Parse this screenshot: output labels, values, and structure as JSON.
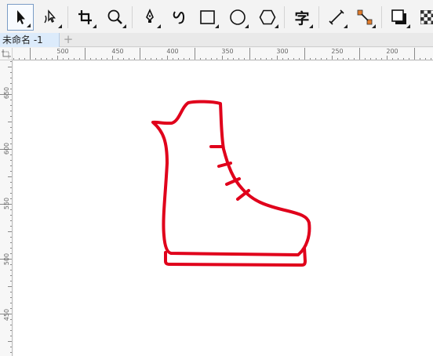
{
  "toolbar": {
    "tools": [
      {
        "name": "pick-tool",
        "active": true
      },
      {
        "name": "shape-tool"
      },
      {
        "name": "crop-tool"
      },
      {
        "name": "zoom-tool"
      },
      {
        "name": "pen-tool"
      },
      {
        "name": "artistic-media-tool"
      },
      {
        "name": "rectangle-tool"
      },
      {
        "name": "ellipse-tool"
      },
      {
        "name": "polygon-tool"
      },
      {
        "name": "text-tool",
        "glyph": "字"
      },
      {
        "name": "dimension-tool"
      },
      {
        "name": "connector-tool"
      },
      {
        "name": "drop-shadow-tool"
      },
      {
        "name": "transparency-tool"
      }
    ]
  },
  "document_tab": {
    "title": "未命名 -1",
    "add_symbol": "+"
  },
  "rulers": {
    "horizontal": [
      "500",
      "450",
      "400",
      "350",
      "300",
      "250",
      "200"
    ],
    "vertical": [
      "650",
      "600",
      "550",
      "500",
      "450"
    ]
  },
  "drawing": {
    "stroke_color": "#e0001b",
    "subject": "ice skate boot outline"
  }
}
